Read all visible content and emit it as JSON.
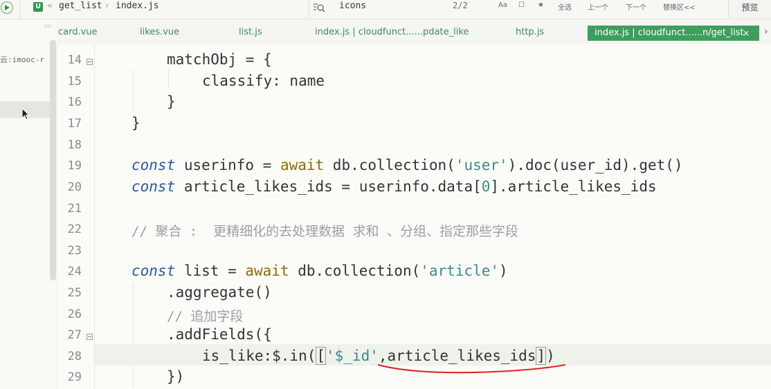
{
  "toolbar": {
    "breadcrumb_chevrons": "«",
    "breadcrumb_project": "get_list",
    "breadcrumb_sep": "›",
    "breadcrumb_file": "index.js",
    "search_text": "icons",
    "match_count": "2/2",
    "options": [
      "Aa",
      "☐",
      "★"
    ],
    "select_all": "全选",
    "prev": "上一个",
    "next": "下一个",
    "replace": "替换区<<",
    "preview": "预览"
  },
  "sidebar": {
    "item_label": "云:imooc-r"
  },
  "tabs": [
    {
      "label": "card.vue"
    },
    {
      "label": "likes.vue"
    },
    {
      "label": "list.js"
    },
    {
      "label": "index.js | cloudfunct......pdate_like"
    },
    {
      "label": "http.js"
    }
  ],
  "active_tab": {
    "label": "index.js | cloudfunct......n/get_list",
    "close": "×"
  },
  "tab_scroll": "›",
  "code_lines": [
    {
      "num": "14",
      "text": "matchObj = {"
    },
    {
      "num": "15",
      "text": "classify: name"
    },
    {
      "num": "16",
      "text": "}"
    },
    {
      "num": "17",
      "text": "}"
    },
    {
      "num": "18",
      "text": ""
    },
    {
      "num": "19",
      "kw": "const",
      "a": " userinfo = ",
      "aw": "await",
      "b": " db.collection(",
      "str": "'user'",
      "c": ").doc(user_id).get()"
    },
    {
      "num": "20",
      "kw": "const",
      "a": " article_likes_ids = userinfo.data[",
      "n": "0",
      "c": "].article_likes_ids"
    },
    {
      "num": "21",
      "text": ""
    },
    {
      "num": "22",
      "cmt": "// 聚合 :  更精细化的去处理数据 求和 、分组、指定那些字段"
    },
    {
      "num": "23",
      "text": ""
    },
    {
      "num": "24",
      "kw": "const",
      "a": " list = ",
      "aw": "await",
      "b": " db.collection(",
      "str": "'article'",
      "c": ")"
    },
    {
      "num": "25",
      "text": ".aggregate()"
    },
    {
      "num": "26",
      "cmt": "// 追加字段"
    },
    {
      "num": "27",
      "text": ".addFields({"
    },
    {
      "num": "28",
      "a": "is_like:$.in(",
      "b1": "[",
      "str": "'$_id'",
      "c": ",article_likes_ids",
      "b2": "]",
      "d": ")"
    },
    {
      "num": "29",
      "text": "})"
    }
  ]
}
